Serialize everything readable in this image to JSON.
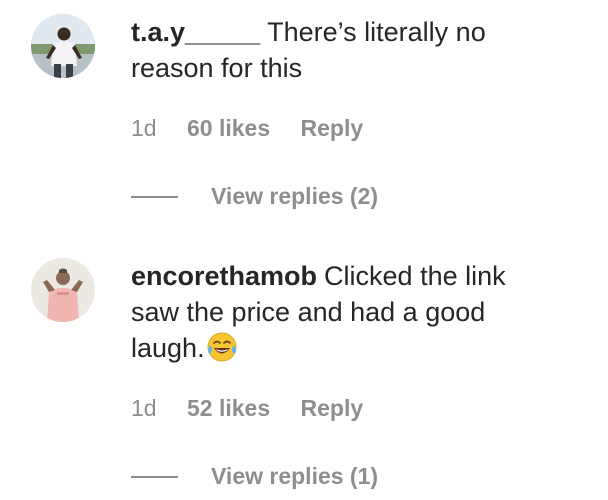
{
  "comments": [
    {
      "username": "t.a.y_____",
      "text": "There’s literally no reason for this",
      "avatar_icon": "profile-photo-man-white-shirt",
      "time": "1d",
      "likes": "60 likes",
      "reply_label": "Reply",
      "view_replies_label": "View replies (2)"
    },
    {
      "username": "encorethamob",
      "text": "Clicked the link saw the price and had a good laugh.",
      "emoji_icon": "face-with-tears-of-joy-emoji",
      "avatar_icon": "profile-photo-man-pink-shirt",
      "time": "1d",
      "likes": "52 likes",
      "reply_label": "Reply",
      "view_replies_label": "View replies (1)"
    }
  ],
  "colors": {
    "primary_text": "#262626",
    "secondary_text": "#8e8e8e"
  }
}
